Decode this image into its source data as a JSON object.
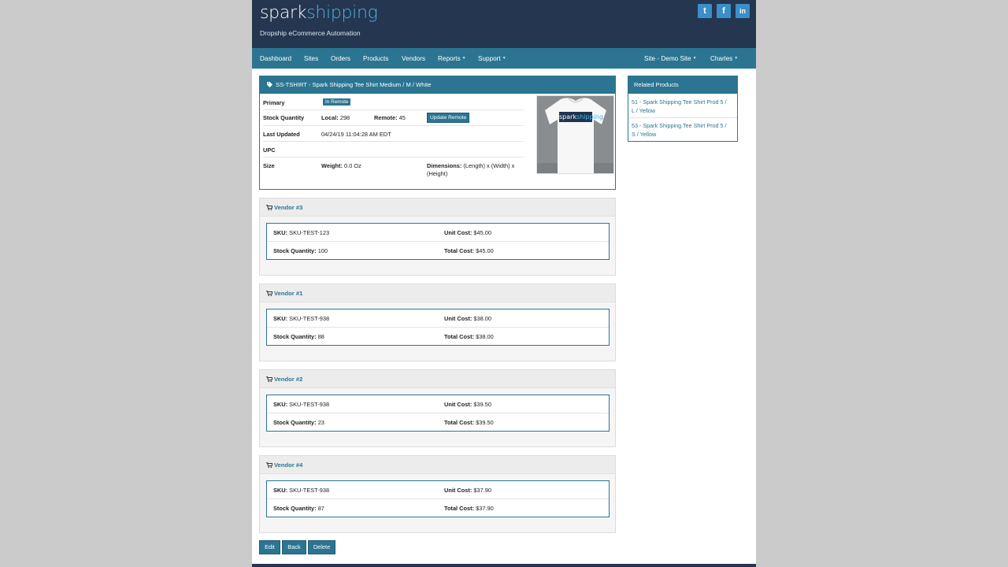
{
  "brand": {
    "logo_part1": "spark",
    "logo_part2": "shipping",
    "tagline": "Dropship eCommerce Automation"
  },
  "social": {
    "twitter_glyph": "t",
    "facebook_glyph": "f",
    "linkedin_glyph": "in"
  },
  "nav": {
    "items": [
      "Dashboard",
      "Sites",
      "Orders",
      "Products",
      "Vendors",
      "Reports",
      "Support"
    ],
    "site_label": "Site - Demo Site",
    "user_label": "Charles"
  },
  "product": {
    "title": "SS-TSHIRT - Spark Shipping Tee Shirt Medium / M / White",
    "primary_label": "Primary",
    "primary_badge": "In Remote",
    "stock_label": "Stock Quantity",
    "local_label": "Local:",
    "local_value": "298",
    "remote_label": "Remote:",
    "remote_value": "45",
    "update_remote_button": "Update Remote",
    "last_updated_label": "Last Updated",
    "last_updated_value": "04/24/19 11:04:28 AM EDT",
    "upc_label": "UPC",
    "size_label": "Size",
    "weight_label": "Weight:",
    "weight_value": "0.0 Oz",
    "dimensions_label": "Dimensions:",
    "dimensions_value_1": "(Length) x (Width) x",
    "dimensions_value_2": "(Height)",
    "image_logo_part1": "spark",
    "image_logo_part2": "shipping"
  },
  "related": {
    "title": "Related Products",
    "items": [
      {
        "line1": "51 - Spark Shipping Tee Shirt Prod 5 /",
        "line2": "L / Yellow"
      },
      {
        "line1": "53 - Spark Shipping Tee Shirt Prod 5 /",
        "line2": "S / Yellow"
      }
    ]
  },
  "vendor_labels": {
    "sku": "SKU:",
    "unit_cost": "Unit Cost:",
    "stock_quantity": "Stock Quantity:",
    "total_cost": "Total Cost:"
  },
  "vendors": [
    {
      "name": "Vendor #3",
      "sku": "SKU-TEST-123",
      "unit_cost": "$45.00",
      "stock_quantity": "100",
      "total_cost": "$45.00"
    },
    {
      "name": "Vendor #1",
      "sku": "SKU-TEST-938",
      "unit_cost": "$38.00",
      "stock_quantity": "88",
      "total_cost": "$38.00"
    },
    {
      "name": "Vendor #2",
      "sku": "SKU-TEST-938",
      "unit_cost": "$39.50",
      "stock_quantity": "23",
      "total_cost": "$39.50"
    },
    {
      "name": "Vendor #4",
      "sku": "SKU-TEST-938",
      "unit_cost": "$37.90",
      "stock_quantity": "87",
      "total_cost": "$37.90"
    }
  ],
  "actions": {
    "edit": "Edit",
    "back": "Back",
    "delete": "Delete"
  },
  "colors": {
    "header_bg": "#253650",
    "nav_bg": "#2b7592",
    "accent": "#4cb5e0",
    "page_bg": "#cbcbcb"
  }
}
